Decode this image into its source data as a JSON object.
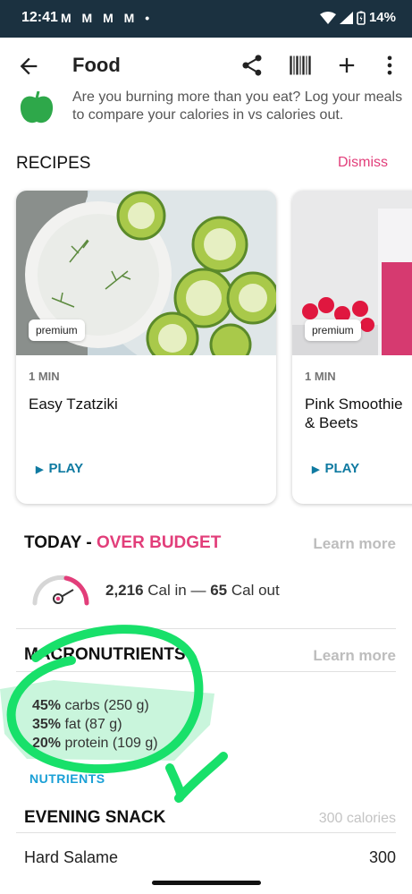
{
  "status_bar": {
    "time": "12:41",
    "notifications": "M M M M •",
    "battery": "14%"
  },
  "app_bar": {
    "title": "Food",
    "icons": [
      "arrow-back-icon",
      "share-icon",
      "barcode-icon",
      "add-icon",
      "more-vert-icon"
    ]
  },
  "info": {
    "text": "Are you burning more than you eat? Log your meals to compare your calories in vs calories out."
  },
  "recipes": {
    "title": "RECIPES",
    "dismiss_label": "Dismiss",
    "items": [
      {
        "premium": "premium",
        "duration": "1 MIN",
        "name": "Easy Tzatziki",
        "play": "PLAY"
      },
      {
        "premium": "premium",
        "duration": "1 MIN",
        "name": "Pink Smoothie & Beets",
        "play": "PLAY"
      }
    ]
  },
  "today": {
    "title": "TODAY",
    "separator": " - ",
    "status": "OVER BUDGET",
    "learn_more": "Learn more",
    "cal_in": "2,216",
    "cal_in_label": "Cal in",
    "dash": "—",
    "cal_out": "65",
    "cal_out_label": "Cal out"
  },
  "macros": {
    "title": "MACRONUTRIENTS",
    "learn_more": "Learn more",
    "items": [
      {
        "percent": "45%",
        "label": "carbs (250 g)"
      },
      {
        "percent": "35%",
        "label": "fat (87 g)"
      },
      {
        "percent": "20%",
        "label": "protein (109 g)"
      }
    ],
    "nutrients_link": "NUTRIENTS"
  },
  "evening_snack": {
    "title": "EVENING SNACK",
    "calories": "300 calories",
    "items": [
      {
        "name": "Hard Salame",
        "calories": "300"
      }
    ]
  },
  "colors": {
    "status_bar": "#1b3140",
    "over_budget": "#e23e7a",
    "play": "#0f7aa1",
    "nutrients": "#1aa0d6",
    "annotation": "#18e06a"
  }
}
